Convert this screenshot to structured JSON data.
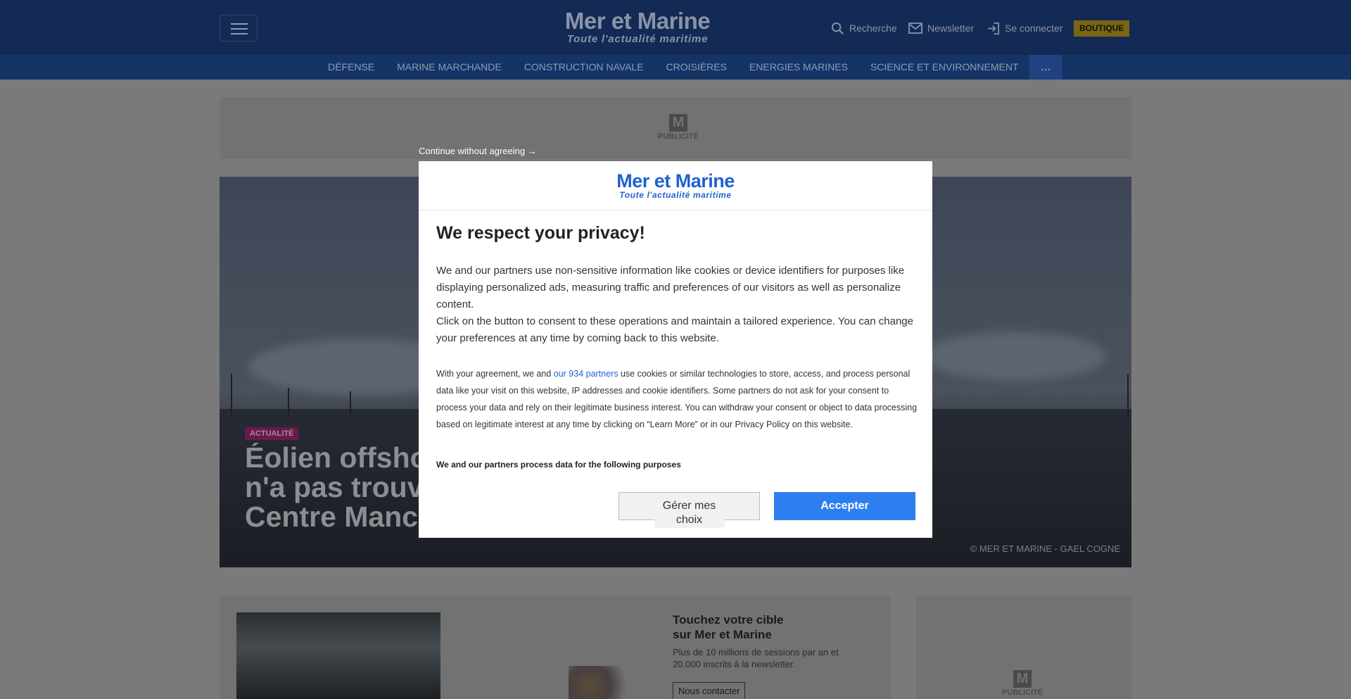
{
  "header": {
    "logo_main": "Mer et Marine",
    "logo_sub": "Toute  l'actualité  maritime",
    "search_label": "Recherche",
    "newsletter_label": "Newsletter",
    "login_label": "Se connecter",
    "shop_label": "BOUTIQUE"
  },
  "nav": {
    "items": [
      "DÉFENSE",
      "MARINE MARCHANDE",
      "CONSTRUCTION NAVALE",
      "CROISIÈRES",
      "ENERGIES MARINES",
      "SCIENCE ET ENVIRONNEMENT"
    ],
    "more_label": "..."
  },
  "ad": {
    "logo_letter": "M",
    "label": "PUBLICITÉ"
  },
  "hero": {
    "badge": "ACTUALITÉ",
    "title_line1": "Éolien offshore :",
    "title_line2": "n'a pas trouvé",
    "title_line3": "Centre Manche",
    "credit": "© MER ET MARINE - GAEL COGNE"
  },
  "promo": {
    "title_line1": "Touchez votre cible",
    "title_line2": "sur Mer et Marine",
    "text": "Plus de 10 millions de sessions par an et 20.000 inscrits à la newsletter.",
    "button": "Nous contacter"
  },
  "consent": {
    "continue_link": "Continue without agreeing →",
    "logo_main": "Mer et Marine",
    "logo_sub": "Toute  l'actualité  maritime",
    "heading": "We respect your privacy!",
    "para1": "We and our partners use non-sensitive information like cookies or device identifiers for purposes like displaying personalized ads, measuring traffic and preferences of our visitors as well as personalize content.",
    "para1b": "Click on the button to consent to these operations and maintain a tailored experience. You can change your preferences at any time by coming back to this website.",
    "para2_start": "With your agreement, we and ",
    "partners_link": "our 934 partners",
    "para2_end": " use cookies or similar technologies to store, access, and process personal data like your visit on this website, IP addresses and cookie identifiers. Some partners do not ask for your consent to process your data and rely on their legitimate business interest. You can withdraw your consent or object to data processing based on legitimate interest at any time by clicking on “Learn More” or in our Privacy Policy on this website.",
    "purposes_heading": "We and our partners process data for the following purposes",
    "manage_line1": "Gérer mes",
    "manage_line2": "choix",
    "accept_label": "Accepter"
  },
  "colors": {
    "header_bg": "#132a55",
    "nav_bg": "#153466",
    "accent_blue": "#2d7ff0",
    "brand_blue": "#1d62d3",
    "shop_yellow": "#f5c518"
  }
}
